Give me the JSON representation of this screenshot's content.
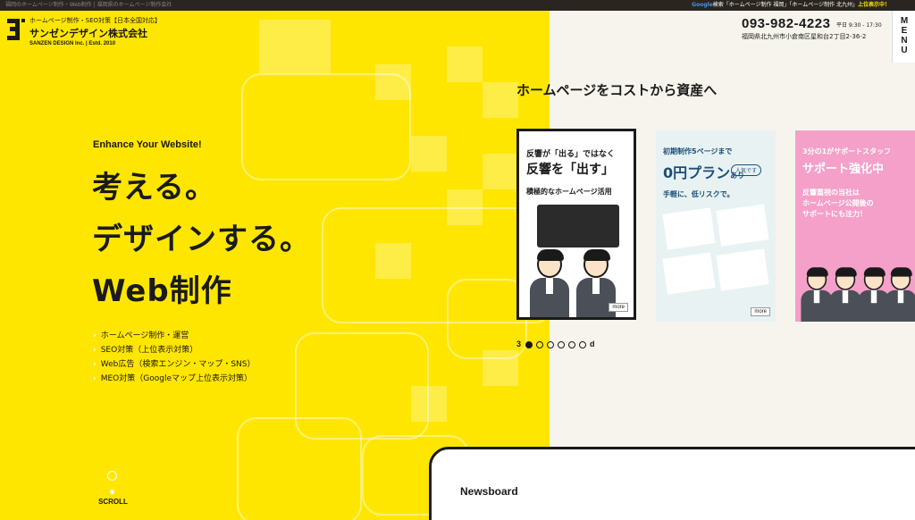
{
  "topbar": {
    "left": "福岡のホームページ制作・Web制作 | 福岡県のホームページ制作会社",
    "right_google": "Google",
    "right_text": "検索「ホームページ制作 福岡」「ホームページ制作 北九州」",
    "right_highlight": "上位表示中！"
  },
  "logo": {
    "sub": "ホームページ制作・SEO対策【日本全国対応】",
    "name": "サンゼンデザイン株式会社",
    "est": "SANZEN DESIGN Inc. | Estd. 2010"
  },
  "header": {
    "phone": "093-982-4223",
    "hours": "平日 9:30 - 17:30",
    "address": "福岡県北九州市小倉南区星和台2丁目2-36-2",
    "menu": [
      "M",
      "E",
      "N",
      "U"
    ]
  },
  "hero": {
    "enhance": "Enhance Your Website!",
    "line1": "考える。",
    "line2": "デザインする。",
    "line3": "Web制作",
    "services": [
      "ホームページ制作・運営",
      "SEO対策（上位表示対策）",
      "Web広告（検索エンジン・マップ・SNS）",
      "MEO対策（Googleマップ上位表示対策）"
    ],
    "scroll": "SCROLL"
  },
  "slider": {
    "tagline": "ホームページをコストから資産へ",
    "cards": [
      {
        "line1": "反響が「出る」ではなく",
        "line2": "反響を「出す」",
        "line3": "積極的なホームページ活用",
        "more": "more"
      },
      {
        "line1": "初期制作5ページまで",
        "line2": "0円プラン",
        "line2b": "あり",
        "badge": "人気です",
        "line3": "手軽に、低リスクで。",
        "more": "more"
      },
      {
        "line1": "3分の1がサポートスタッフ",
        "line2": "サポート強化中",
        "line3": "反響重視の当社は",
        "line4": "ホームページ公開後の",
        "line5": "サポートにも注力！"
      }
    ],
    "pager_start": "3",
    "pager_end": "d"
  },
  "newsboard": {
    "title": "Newsboard"
  }
}
